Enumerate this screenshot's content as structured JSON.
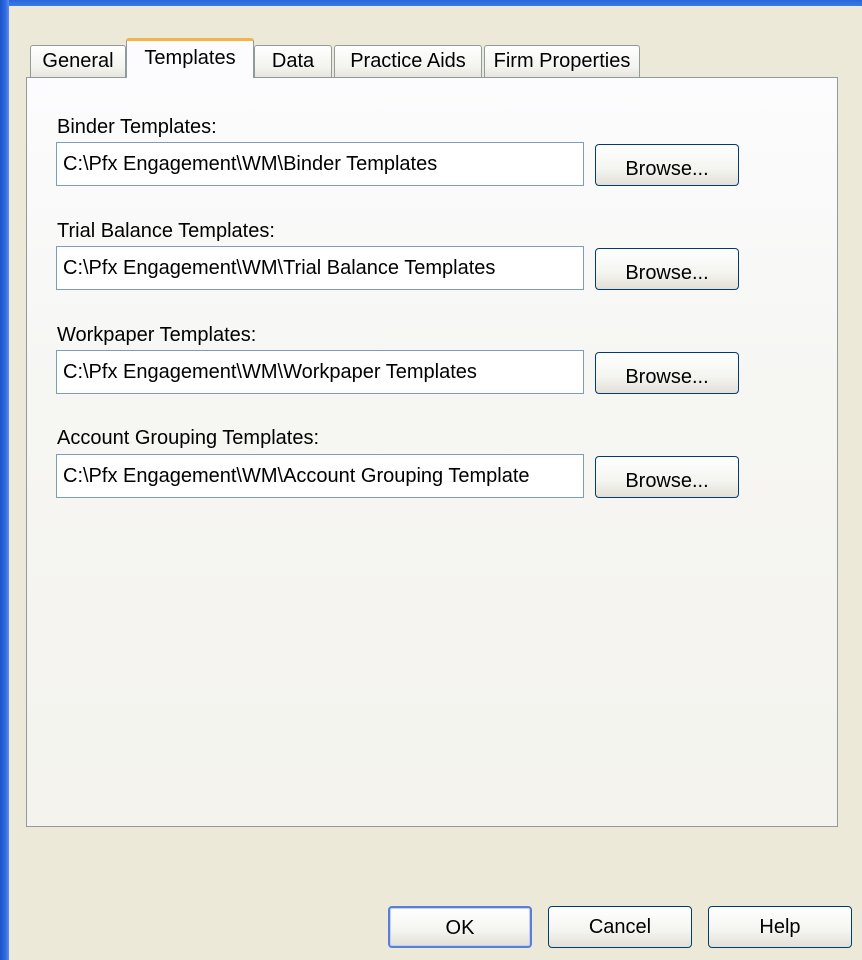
{
  "tabs": [
    {
      "label": "General",
      "active": false
    },
    {
      "label": "Templates",
      "active": true
    },
    {
      "label": "Data",
      "active": false
    },
    {
      "label": "Practice Aids",
      "active": false
    },
    {
      "label": "Firm Properties",
      "active": false
    }
  ],
  "fields": {
    "binder": {
      "label": "Binder Templates:",
      "value": "C:\\Pfx Engagement\\WM\\Binder Templates",
      "browse_label": "Browse..."
    },
    "trial_balance": {
      "label": "Trial Balance Templates:",
      "value": "C:\\Pfx Engagement\\WM\\Trial Balance Templates",
      "browse_label": "Browse..."
    },
    "workpaper": {
      "label": "Workpaper Templates:",
      "value": "C:\\Pfx Engagement\\WM\\Workpaper Templates",
      "browse_label": "Browse..."
    },
    "account_grouping": {
      "label": "Account Grouping Templates:",
      "value": "C:\\Pfx Engagement\\WM\\Account Grouping Template",
      "browse_label": "Browse..."
    }
  },
  "footer": {
    "ok_label": "OK",
    "cancel_label": "Cancel",
    "help_label": "Help"
  },
  "colors": {
    "dialog_background": "#ece9d8",
    "active_tab_highlight": "#f5b245",
    "window_frame": "#2b64d9",
    "input_border": "#7f9db9",
    "button_border": "#003c74"
  }
}
